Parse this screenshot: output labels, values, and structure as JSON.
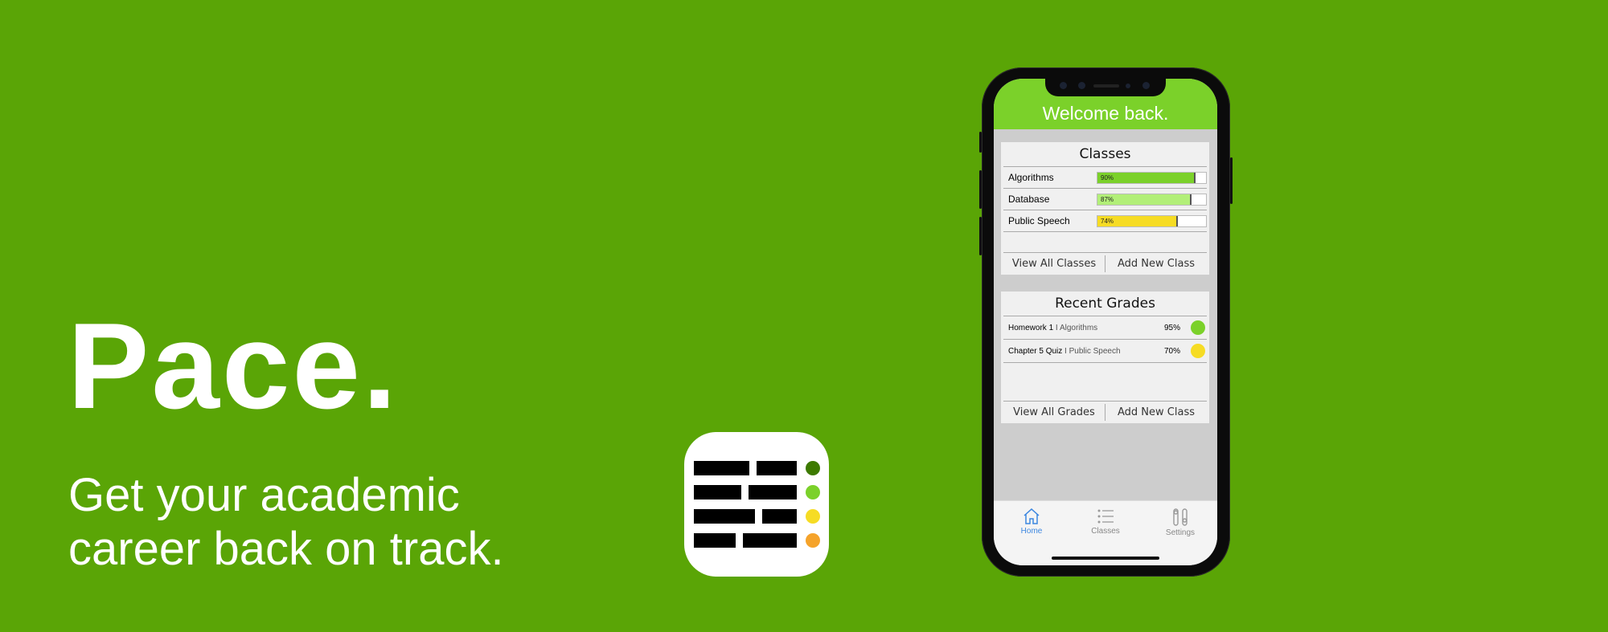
{
  "hero": {
    "title": "Pace.",
    "tagline_line1": "Get your academic",
    "tagline_line2": "career back on track."
  },
  "colors": {
    "background": "#5aa506",
    "header": "#7bd12a",
    "grade_high": "#7bd12a",
    "grade_mid": "#a9ec6b",
    "grade_low": "#f6dc24",
    "accent_orange": "#f5a32a",
    "tab_active": "#3b86e0"
  },
  "app_icon": {
    "name": "pace-app-icon",
    "dot_colors": [
      "#3d7a00",
      "#7bd12a",
      "#f6dc24",
      "#f5a32a"
    ]
  },
  "app": {
    "header_title": "Welcome back.",
    "classes_card": {
      "title": "Classes",
      "items": [
        {
          "name": "Algorithms",
          "percent_label": "90%",
          "fraction": 0.9,
          "color": "#7bd12a"
        },
        {
          "name": "Database",
          "percent_label": "87%",
          "fraction": 0.87,
          "color": "#b2ef78"
        },
        {
          "name": "Public Speech",
          "percent_label": "74%",
          "fraction": 0.74,
          "color": "#f6dc24"
        }
      ],
      "view_all_label": "View All Classes",
      "add_label": "Add New Class"
    },
    "grades_card": {
      "title": "Recent Grades",
      "items": [
        {
          "assignment": "Homework 1",
          "class_name": "Algorithms",
          "percent_label": "95%",
          "color": "#7bd12a"
        },
        {
          "assignment": "Chapter 5 Quiz",
          "class_name": "Public Speech",
          "percent_label": "70%",
          "color": "#f6dc24"
        }
      ],
      "separator": "I",
      "view_all_label": "View All Grades",
      "add_label": "Add New Class"
    },
    "tabs": [
      {
        "label": "Home",
        "icon": "home-icon",
        "active": true
      },
      {
        "label": "Classes",
        "icon": "list-icon",
        "active": false
      },
      {
        "label": "Settings",
        "icon": "settings-icon",
        "active": false
      }
    ]
  }
}
